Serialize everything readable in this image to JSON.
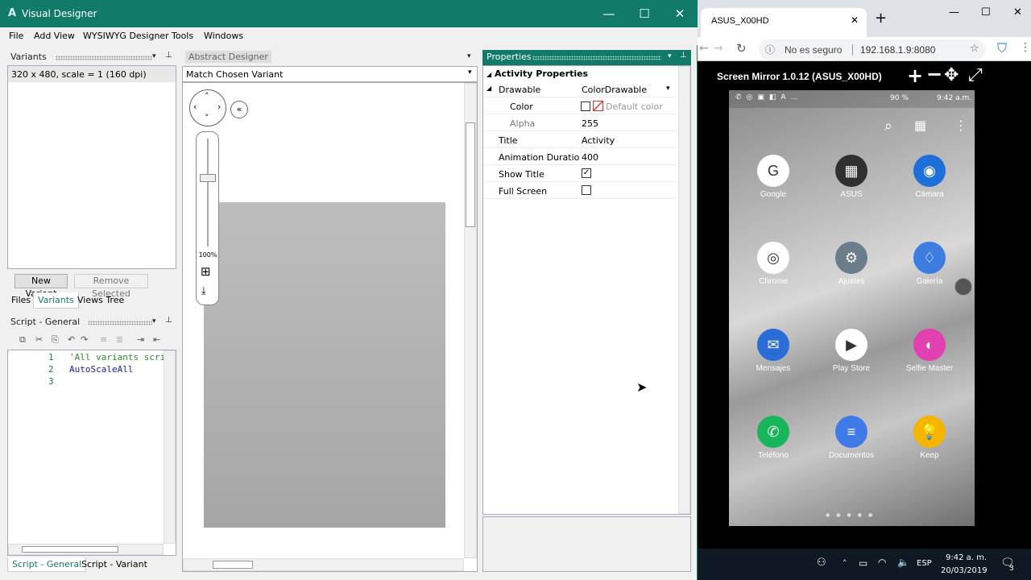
{
  "window": {
    "logo": "A",
    "title": "Visual Designer",
    "controls": {
      "minimize": "—",
      "maximize": "☐",
      "close": "✕"
    }
  },
  "menu": [
    "File",
    "Add View",
    "WYSIWYG Designer",
    "Tools",
    "Windows"
  ],
  "variants": {
    "title": "Variants",
    "items": [
      "320 x 480, scale = 1 (160 dpi)"
    ],
    "new_button": "New Variant",
    "remove_button": "Remove Selected",
    "tabs": [
      "Files",
      "Variants",
      "Views Tree"
    ]
  },
  "script": {
    "title": "Script - General",
    "lines": [
      {
        "num": "1",
        "code": "'All variants scri"
      },
      {
        "num": "2",
        "code": "AutoScaleAll"
      },
      {
        "num": "3",
        "code": ""
      }
    ],
    "tabs": [
      "Script - General",
      "Script - Variant"
    ]
  },
  "designer": {
    "title": "Abstract Designer",
    "variant_select": "Match Chosen Variant",
    "zoom_label": "100%",
    "zoom_level": 0.75
  },
  "properties": {
    "title": "Properties",
    "section": "Activity Properties",
    "rows": [
      {
        "key": "Drawable",
        "value": "ColorDrawable"
      },
      {
        "key": "Color",
        "value": "Default color"
      },
      {
        "key": "Alpha",
        "value": "255"
      },
      {
        "key": "Title",
        "value": "Activity"
      },
      {
        "key": "Animation Duration",
        "value": "400"
      },
      {
        "key": "Show Title",
        "value": ""
      },
      {
        "key": "Full Screen",
        "value": ""
      }
    ],
    "show_title_checked": true,
    "full_screen_checked": false
  },
  "browser": {
    "tab_title": "ASUS_X00HD",
    "not_secure": "No es seguro",
    "url": "192.168.1.9:8080",
    "page_heading": "Screen Mirror 1.0.12 (ASUS_X00HD)",
    "new_tab": "+"
  },
  "phone": {
    "battery": "90 %",
    "time": "9:42 a.m.",
    "apps": [
      {
        "label": "Google",
        "color": "#ffffff"
      },
      {
        "label": "ASUS",
        "color": "#303030"
      },
      {
        "label": "Cámara",
        "color": "#1e6fd9"
      },
      {
        "label": "Chrome",
        "color": "#ffffff"
      },
      {
        "label": "Ajustes",
        "color": "#6b7c8a"
      },
      {
        "label": "Galería",
        "color": "#3d7de0"
      },
      {
        "label": "Mensajes",
        "color": "#2c6cd6"
      },
      {
        "label": "Play Store",
        "color": "#ffffff"
      },
      {
        "label": "Selfie Master",
        "color": "#e040b0"
      },
      {
        "label": "Teléfono",
        "color": "#19b55a"
      },
      {
        "label": "Documentos",
        "color": "#3f7ae8"
      },
      {
        "label": "Keep",
        "color": "#f5b400"
      }
    ]
  },
  "taskbar": {
    "lang": "ESP",
    "time": "9:42 a. m.",
    "date": "20/03/2019",
    "notifications": "3"
  }
}
